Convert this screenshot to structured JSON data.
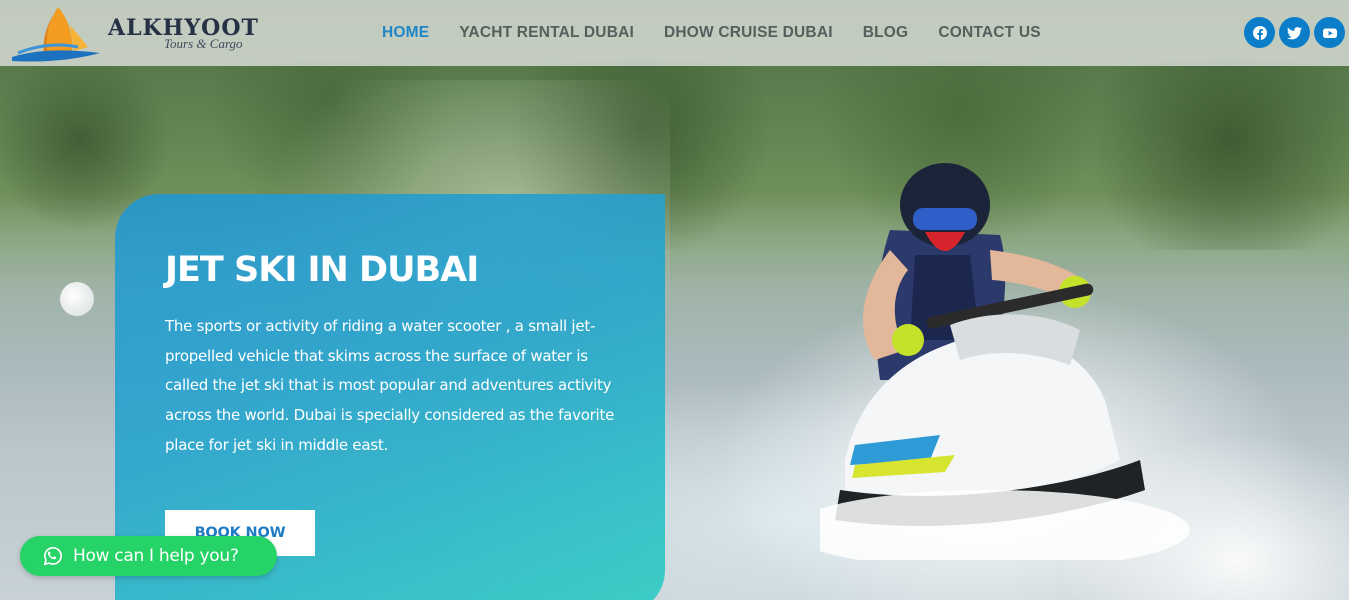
{
  "header": {
    "logo": {
      "name": "ALKHYOOT",
      "tagline": "Tours & Cargo"
    },
    "nav": [
      {
        "label": "HOME",
        "active": true
      },
      {
        "label": "YACHT RENTAL DUBAI",
        "active": false
      },
      {
        "label": "DHOW CRUISE DUBAI",
        "active": false
      },
      {
        "label": "BLOG",
        "active": false
      },
      {
        "label": "CONTACT US",
        "active": false
      }
    ],
    "social": [
      {
        "icon": "facebook-icon"
      },
      {
        "icon": "twitter-icon"
      },
      {
        "icon": "youtube-icon"
      }
    ]
  },
  "hero": {
    "title": "JET SKI IN DUBAI",
    "description": "The sports or activity of riding a water scooter , a small jet-propelled vehicle that skims across the surface of water is called the jet ski that is most popular and adventures activity across the world. Dubai is specially considered as the favorite place for jet ski in middle east.",
    "cta_label": "BOOK NOW"
  },
  "whatsapp": {
    "label": "How can I help you?",
    "icon": "whatsapp-icon"
  },
  "colors": {
    "accent": "#1e86c8",
    "social": "#0c7ec9",
    "card_start": "#2196d2",
    "card_end": "#34cdc4",
    "whatsapp": "#25d366"
  }
}
